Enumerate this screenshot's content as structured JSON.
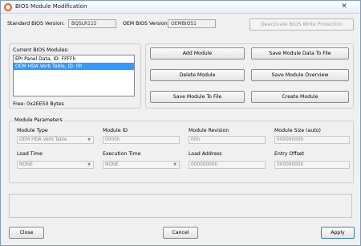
{
  "window": {
    "title": "BIOS Module Modification",
    "close_glyph": "✕"
  },
  "header": {
    "std_bios_label": "Standard BIOS Version:",
    "std_bios_value": "BQSLR115",
    "oem_bios_label": "OEM BIOS Version:",
    "oem_bios_value": "OEMBIOS1",
    "deactivate_label": "Deactivate BIOS Write Protection"
  },
  "modules": {
    "title": "Current BIOS Modules:",
    "items": [
      "EPI Panel Data, ID: FFFFh",
      "OEM HDA Verb Table, ID: 0h"
    ],
    "free_label": "Free: 0x2EE50 Bytes"
  },
  "actions": {
    "add": "Add Module",
    "save_data": "Save Module Data To File",
    "delete": "Delete Module",
    "overview": "Save Module Overview",
    "save_to_file": "Save Module To File",
    "create": "Create Module"
  },
  "params": {
    "title": "Module Parameters",
    "module_type_label": "Module Type",
    "module_type_value": "OEM HDA Verb Table",
    "module_id_label": "Module ID",
    "module_id_value": "0000h",
    "module_revision_label": "Module Revision",
    "module_revision_value": "00h",
    "module_size_label": "Module Size (auto)",
    "module_size_value": "00000000h",
    "load_time_label": "Load Time",
    "load_time_value": "NONE",
    "exec_time_label": "Execution Time",
    "exec_time_value": "NONE",
    "load_address_label": "Load Address",
    "load_address_value": "00000000h",
    "entry_offset_label": "Entry Offset",
    "entry_offset_value": "00000000h"
  },
  "footer": {
    "close": "Close",
    "cancel": "Cancel",
    "apply": "Apply"
  }
}
